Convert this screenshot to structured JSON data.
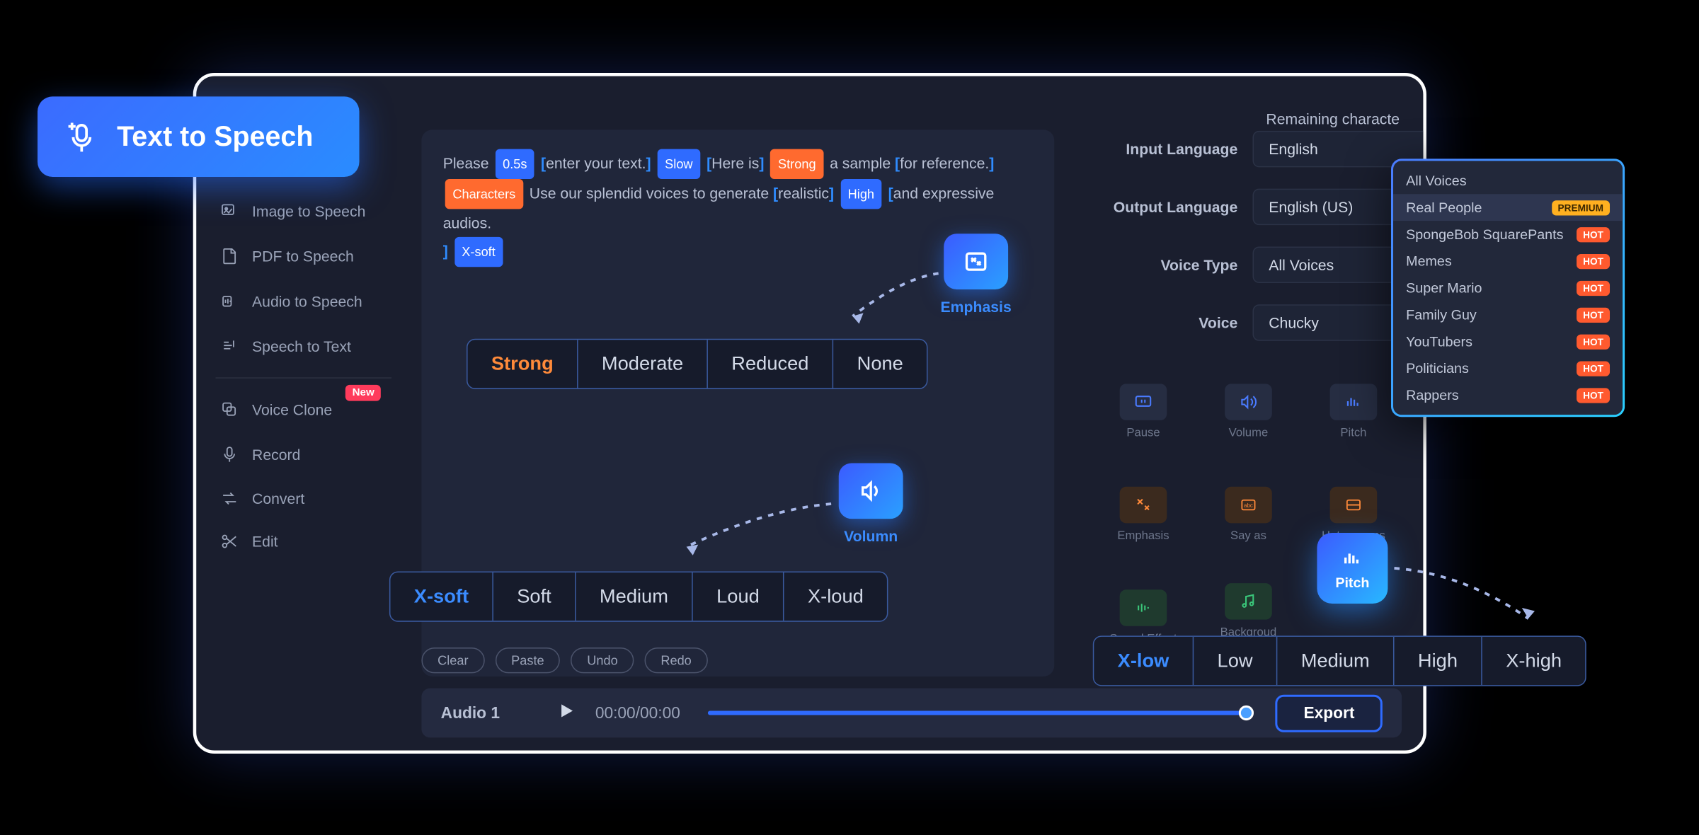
{
  "badge": {
    "label": "Text  to Speech"
  },
  "sidebar": {
    "items": [
      {
        "label": "Image to Speech"
      },
      {
        "label": "PDF to Speech"
      },
      {
        "label": "Audio to Speech"
      },
      {
        "label": "Speech to Text"
      },
      {
        "label": "Voice Clone",
        "badge": "New"
      },
      {
        "label": "Record"
      },
      {
        "label": "Convert"
      },
      {
        "label": "Edit"
      }
    ]
  },
  "header": {
    "remaining": "Remaining characte"
  },
  "editor": {
    "t0": "Please",
    "tag_05s": "0.5s",
    "t1": "enter your text.",
    "tag_slow": "Slow",
    "t2": "Here is",
    "tag_strong": "Strong",
    "t3": "a sample",
    "t4": "for reference.",
    "tag_chars": "Characters",
    "t5": "Use our splendid voices to generate",
    "t6": "realistic",
    "tag_high": "High",
    "t7": "and expressive audios.",
    "tag_xsoft": "X-soft"
  },
  "fields": {
    "input_lang": {
      "label": "Input Language",
      "value": "English"
    },
    "output_lang": {
      "label": "Output Language",
      "value": "English (US)"
    },
    "voice_type": {
      "label": "Voice Type",
      "value": "All Voices"
    },
    "voice": {
      "label": "Voice",
      "value": "Chucky"
    }
  },
  "tools": {
    "pause": "Pause",
    "volume": "Volume",
    "pitch": "Pitch",
    "emphasis": "Emphasis",
    "sayas": "Say as",
    "heteronyms": "Heteronyms",
    "sound": "Sound Effect",
    "bgm": "Backgroud Music",
    "pitch_active": "Pitch"
  },
  "floating": {
    "emphasis": "Emphasis",
    "volume": "Volumn"
  },
  "emphasis_opts": [
    "Strong",
    "Moderate",
    "Reduced",
    "None"
  ],
  "volume_opts": [
    "X-soft",
    "Soft",
    "Medium",
    "Loud",
    "X-loud"
  ],
  "pitch_opts": [
    "X-low",
    "Low",
    "Medium",
    "High",
    "X-high"
  ],
  "bottom": {
    "clear": "Clear",
    "paste": "Paste",
    "undo": "Undo",
    "redo": "Redo",
    "audio_title": "Audio 1",
    "time": "00:00/00:00",
    "export": "Export"
  },
  "dropdown": {
    "items": [
      {
        "label": "All Voices"
      },
      {
        "label": "Real People",
        "badge": "PREMIUM",
        "badge_type": "premium",
        "hl": true
      },
      {
        "label": "SpongeBob SquarePants",
        "badge": "HOT",
        "badge_type": "hot"
      },
      {
        "label": "Memes",
        "badge": "HOT",
        "badge_type": "hot"
      },
      {
        "label": "Super Mario",
        "badge": "HOT",
        "badge_type": "hot"
      },
      {
        "label": "Family Guy",
        "badge": "HOT",
        "badge_type": "hot"
      },
      {
        "label": "YouTubers",
        "badge": "HOT",
        "badge_type": "hot"
      },
      {
        "label": "Politicians",
        "badge": "HOT",
        "badge_type": "hot"
      },
      {
        "label": "Rappers",
        "badge": "HOT",
        "badge_type": "hot"
      }
    ]
  }
}
